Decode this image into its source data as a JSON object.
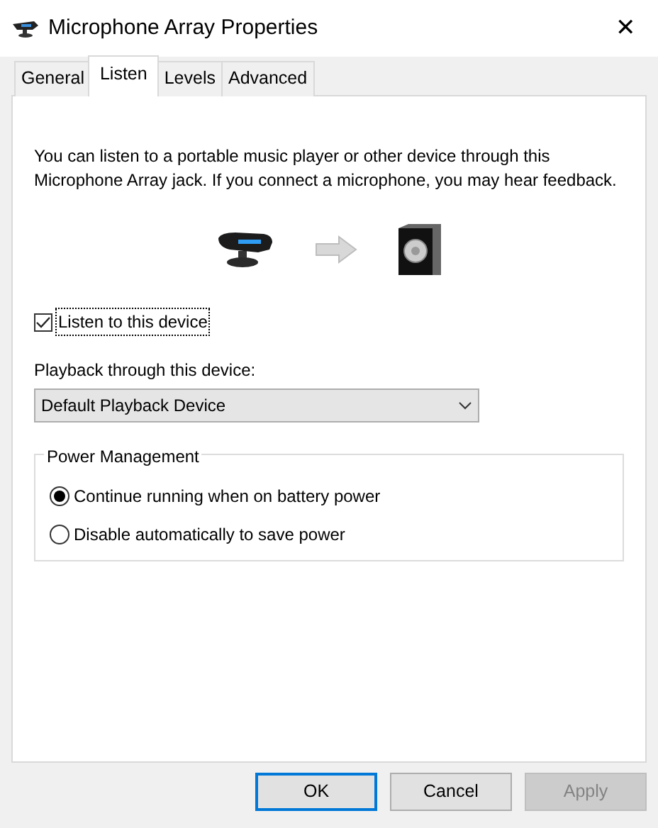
{
  "window": {
    "title": "Microphone Array Properties",
    "close": "✕"
  },
  "tabs": [
    {
      "label": "General",
      "selected": false
    },
    {
      "label": "Listen",
      "selected": true
    },
    {
      "label": "Levels",
      "selected": false
    },
    {
      "label": "Advanced",
      "selected": false
    }
  ],
  "description": "You can listen to a portable music player or other device through this Microphone Array jack.  If you connect a microphone, you may hear feedback.",
  "listen": {
    "label": "Listen to this device",
    "checked": true
  },
  "playback": {
    "label": "Playback through this device:",
    "value": "Default Playback Device"
  },
  "power_management": {
    "title": "Power Management",
    "options": [
      {
        "label": "Continue running when on battery power",
        "selected": true
      },
      {
        "label": "Disable automatically to save power",
        "selected": false
      }
    ]
  },
  "buttons": [
    {
      "label": "OK",
      "default": true,
      "disabled": false
    },
    {
      "label": "Cancel",
      "default": false,
      "disabled": false
    },
    {
      "label": "Apply",
      "default": false,
      "disabled": true
    }
  ]
}
